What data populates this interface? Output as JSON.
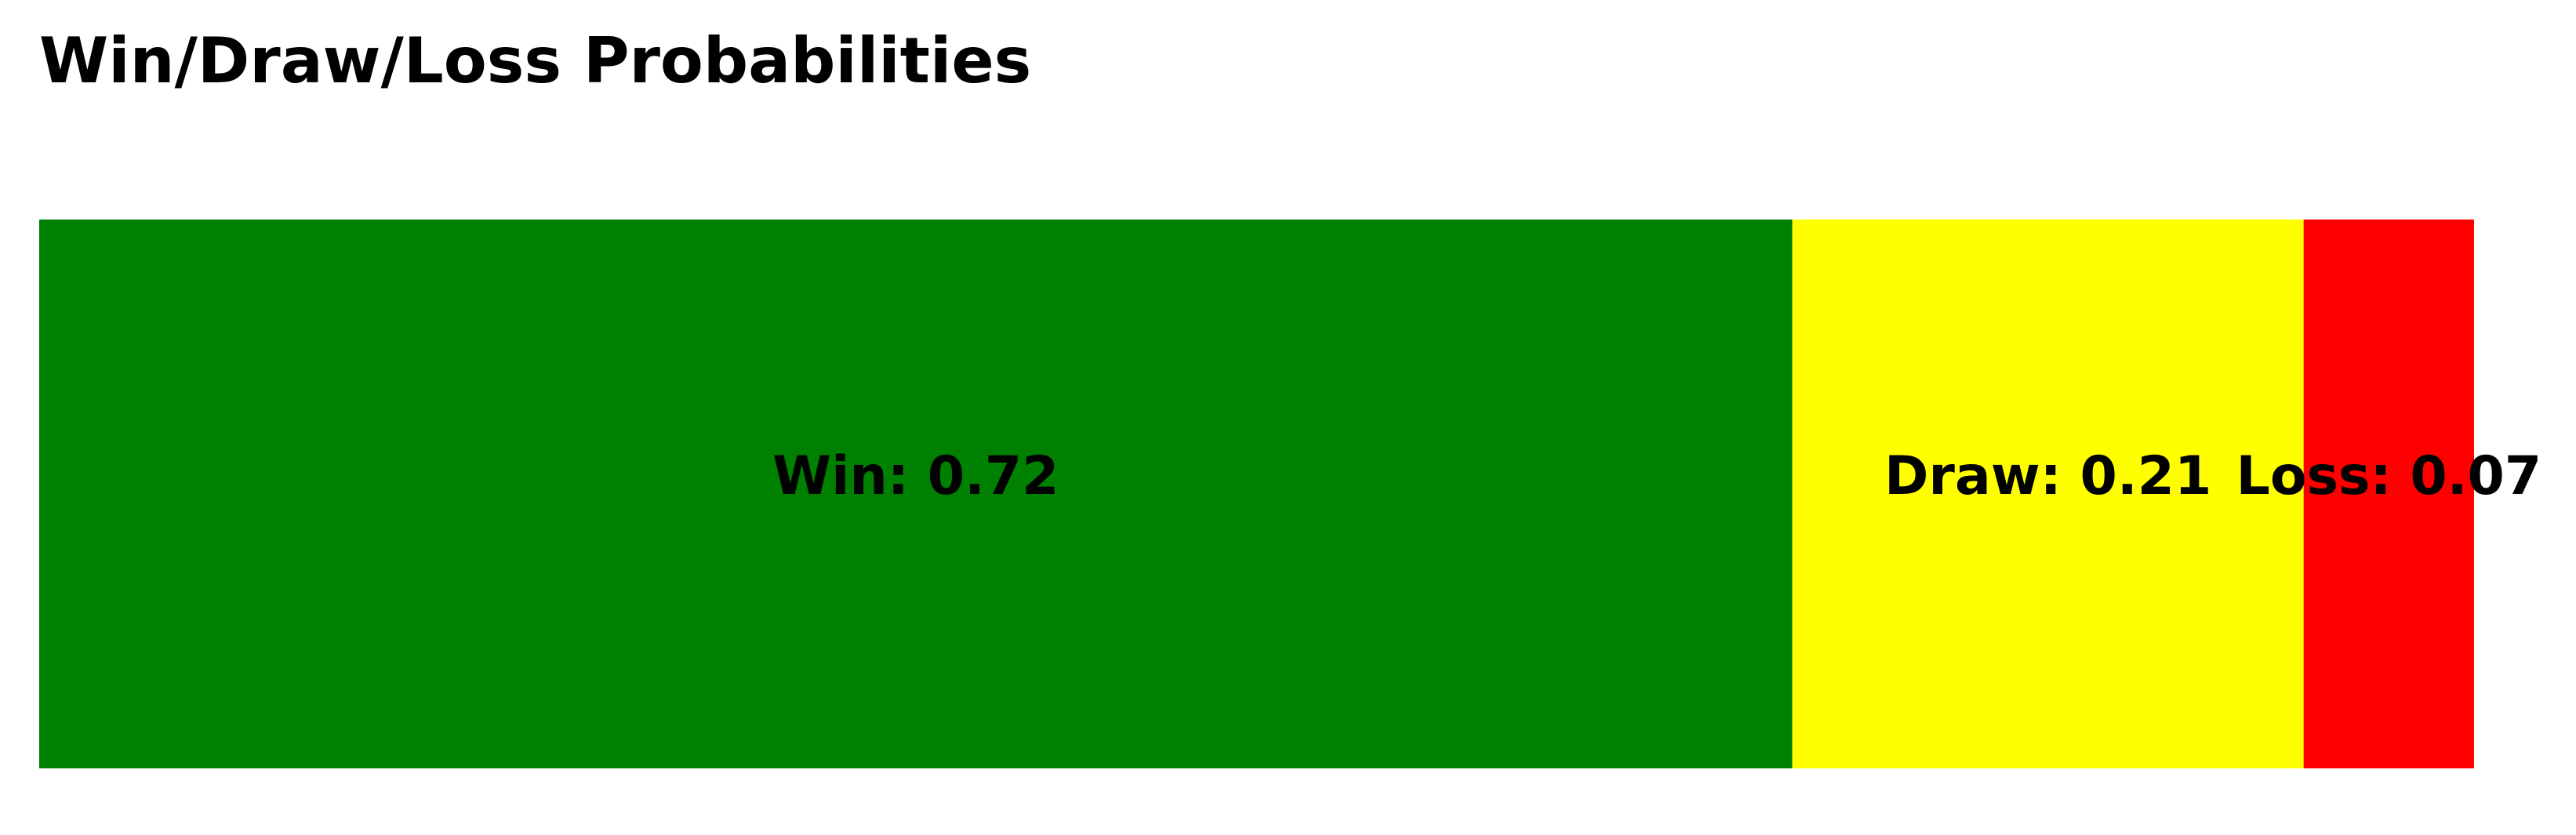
{
  "chart_data": {
    "type": "bar",
    "orientation": "horizontal",
    "stacked": true,
    "title": "Win/Draw/Loss Probabilities",
    "xlim": [
      0,
      1
    ],
    "axes_visible": false,
    "grid": false,
    "legend": "none",
    "segments": [
      {
        "category": "Win",
        "value": 0.72,
        "label": "Win: 0.72",
        "color": "#008000"
      },
      {
        "category": "Draw",
        "value": 0.21,
        "label": "Draw: 0.21",
        "color": "#ffff00"
      },
      {
        "category": "Loss",
        "value": 0.07,
        "label": "Loss: 0.07",
        "color": "#ff0000"
      }
    ]
  }
}
